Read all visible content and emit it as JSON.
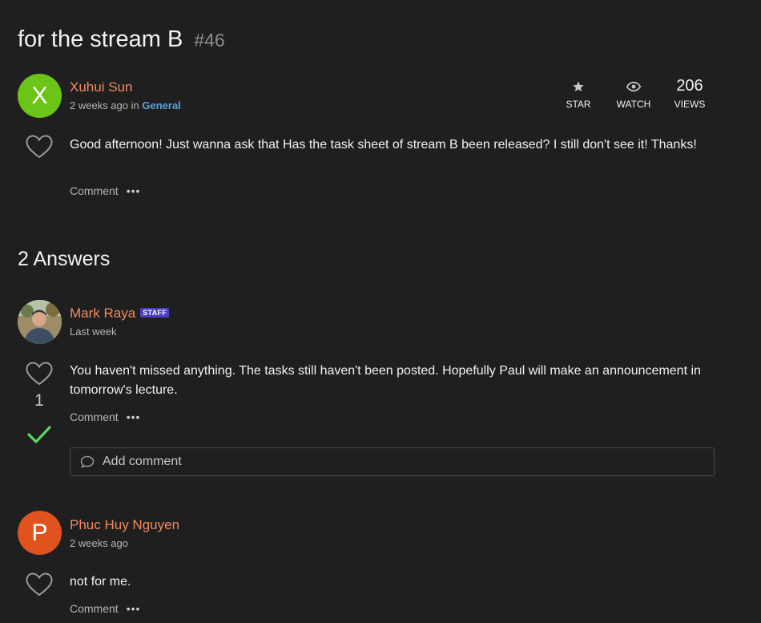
{
  "post": {
    "title": "for the stream B",
    "number": "#46",
    "author": "Xuhui Sun",
    "avatar_letter": "X",
    "time": "2 weeks ago",
    "in_word": "in",
    "category": "General",
    "body": "Good afternoon! Just wanna ask that Has the task sheet of stream B been released? I still don't see it! Thanks!",
    "comment_label": "Comment",
    "more_label": "•••"
  },
  "stats": {
    "star_label": "STAR",
    "watch_label": "WATCH",
    "views_count": "206",
    "views_label": "VIEWS"
  },
  "answers": {
    "heading": "2 Answers",
    "items": [
      {
        "author": "Mark Raya",
        "badge": "STAFF",
        "time": "Last week",
        "body": "You haven't missed anything. The tasks still haven't been posted. Hopefully Paul will make an announcement in tomorrow's lecture.",
        "votes": "1",
        "accepted": true,
        "comment_label": "Comment",
        "more_label": "•••",
        "add_comment_placeholder": "Add comment"
      },
      {
        "author": "Phuc Huy Nguyen",
        "avatar_letter": "P",
        "time": "2 weeks ago",
        "body": "not for me.",
        "comment_label": "Comment",
        "more_label": "•••"
      }
    ]
  },
  "colors": {
    "background": "#1f1f20",
    "author": "#f08a5d",
    "category": "#54a3e0",
    "avatar_x": "#6cc417",
    "avatar_p": "#e0531f",
    "accepted_check": "#5ad95a",
    "staff_badge": "#4b3fc6"
  }
}
